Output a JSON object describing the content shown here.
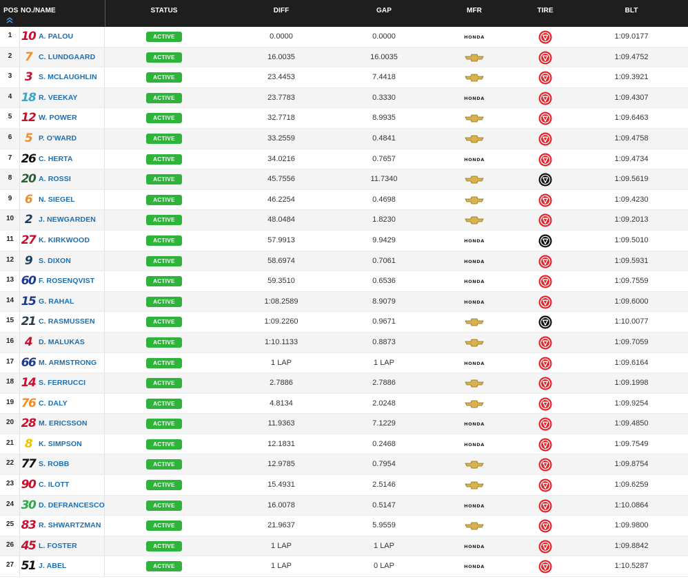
{
  "header": {
    "pos": "POS",
    "name": "NO./NAME",
    "status": "STATUS",
    "diff": "DIFF",
    "gap": "GAP",
    "mfr": "MFR",
    "tire": "TIRE",
    "blt": "BLT",
    "sort_icon": "double-chevron-up-icon"
  },
  "colors": {
    "header_bg": "#1e1e1e",
    "driver_link": "#1a6fb5",
    "status_active": "#2fb43b",
    "tire_alternate": "#e3262b",
    "tire_primary": "#111111"
  },
  "rows": [
    {
      "pos": "1",
      "num": "10",
      "num_color": "#c8102e",
      "name": "A. PALOU",
      "status": "ACTIVE",
      "diff": "0.0000",
      "gap": "0.0000",
      "mfr": "HONDA",
      "tire": "alternate",
      "blt": "1:09.0177"
    },
    {
      "pos": "2",
      "num": "7",
      "num_color": "#f28c28",
      "name": "C. LUNDGAARD",
      "status": "ACTIVE",
      "diff": "16.0035",
      "gap": "16.0035",
      "mfr": "CHEVROLET",
      "tire": "alternate",
      "blt": "1:09.4752"
    },
    {
      "pos": "3",
      "num": "3",
      "num_color": "#c8102e",
      "name": "S. MCLAUGHLIN",
      "status": "ACTIVE",
      "diff": "23.4453",
      "gap": "7.4418",
      "mfr": "CHEVROLET",
      "tire": "alternate",
      "blt": "1:09.3921"
    },
    {
      "pos": "4",
      "num": "18",
      "num_color": "#3aa6c9",
      "name": "R. VEEKAY",
      "status": "ACTIVE",
      "diff": "23.7783",
      "gap": "0.3330",
      "mfr": "HONDA",
      "tire": "alternate",
      "blt": "1:09.4307"
    },
    {
      "pos": "5",
      "num": "12",
      "num_color": "#c8102e",
      "name": "W. POWER",
      "status": "ACTIVE",
      "diff": "32.7718",
      "gap": "8.9935",
      "mfr": "CHEVROLET",
      "tire": "alternate",
      "blt": "1:09.6463"
    },
    {
      "pos": "6",
      "num": "5",
      "num_color": "#f28c28",
      "name": "P. O'WARD",
      "status": "ACTIVE",
      "diff": "33.2559",
      "gap": "0.4841",
      "mfr": "CHEVROLET",
      "tire": "alternate",
      "blt": "1:09.4758"
    },
    {
      "pos": "7",
      "num": "26",
      "num_color": "#111111",
      "name": "C. HERTA",
      "status": "ACTIVE",
      "diff": "34.0216",
      "gap": "0.7657",
      "mfr": "HONDA",
      "tire": "alternate",
      "blt": "1:09.4734"
    },
    {
      "pos": "8",
      "num": "20",
      "num_color": "#2e5e3a",
      "name": "A. ROSSI",
      "status": "ACTIVE",
      "diff": "45.7556",
      "gap": "11.7340",
      "mfr": "CHEVROLET",
      "tire": "primary",
      "blt": "1:09.5619"
    },
    {
      "pos": "9",
      "num": "6",
      "num_color": "#f28c28",
      "name": "N. SIEGEL",
      "status": "ACTIVE",
      "diff": "46.2254",
      "gap": "0.4698",
      "mfr": "CHEVROLET",
      "tire": "alternate",
      "blt": "1:09.4230"
    },
    {
      "pos": "10",
      "num": "2",
      "num_color": "#1d3a5f",
      "name": "J. NEWGARDEN",
      "status": "ACTIVE",
      "diff": "48.0484",
      "gap": "1.8230",
      "mfr": "CHEVROLET",
      "tire": "alternate",
      "blt": "1:09.2013"
    },
    {
      "pos": "11",
      "num": "27",
      "num_color": "#c8102e",
      "name": "K. KIRKWOOD",
      "status": "ACTIVE",
      "diff": "57.9913",
      "gap": "9.9429",
      "mfr": "HONDA",
      "tire": "primary",
      "blt": "1:09.5010"
    },
    {
      "pos": "12",
      "num": "9",
      "num_color": "#1d3a5f",
      "name": "S. DIXON",
      "status": "ACTIVE",
      "diff": "58.6974",
      "gap": "0.7061",
      "mfr": "HONDA",
      "tire": "alternate",
      "blt": "1:09.5931"
    },
    {
      "pos": "13",
      "num": "60",
      "num_color": "#1d3a8f",
      "name": "F. ROSENQVIST",
      "status": "ACTIVE",
      "diff": "59.3510",
      "gap": "0.6536",
      "mfr": "HONDA",
      "tire": "alternate",
      "blt": "1:09.7559"
    },
    {
      "pos": "14",
      "num": "15",
      "num_color": "#1d3a8f",
      "name": "G. RAHAL",
      "status": "ACTIVE",
      "diff": "1:08.2589",
      "gap": "8.9079",
      "mfr": "HONDA",
      "tire": "alternate",
      "blt": "1:09.6000"
    },
    {
      "pos": "15",
      "num": "21",
      "num_color": "#2a3f4f",
      "name": "C. RASMUSSEN",
      "status": "ACTIVE",
      "diff": "1:09.2260",
      "gap": "0.9671",
      "mfr": "CHEVROLET",
      "tire": "primary",
      "blt": "1:10.0077"
    },
    {
      "pos": "16",
      "num": "4",
      "num_color": "#c8102e",
      "name": "D. MALUKAS",
      "status": "ACTIVE",
      "diff": "1:10.1133",
      "gap": "0.8873",
      "mfr": "CHEVROLET",
      "tire": "alternate",
      "blt": "1:09.7059"
    },
    {
      "pos": "17",
      "num": "66",
      "num_color": "#1d3a8f",
      "name": "M. ARMSTRONG",
      "status": "ACTIVE",
      "diff": "1 LAP",
      "gap": "1 LAP",
      "mfr": "HONDA",
      "tire": "alternate",
      "blt": "1:09.6164"
    },
    {
      "pos": "18",
      "num": "14",
      "num_color": "#c8102e",
      "name": "S. FERRUCCI",
      "status": "ACTIVE",
      "diff": "2.7886",
      "gap": "2.7886",
      "mfr": "CHEVROLET",
      "tire": "alternate",
      "blt": "1:09.1998"
    },
    {
      "pos": "19",
      "num": "76",
      "num_color": "#f28c28",
      "name": "C. DALY",
      "status": "ACTIVE",
      "diff": "4.8134",
      "gap": "2.0248",
      "mfr": "CHEVROLET",
      "tire": "alternate",
      "blt": "1:09.9254"
    },
    {
      "pos": "20",
      "num": "28",
      "num_color": "#c8102e",
      "name": "M. ERICSSON",
      "status": "ACTIVE",
      "diff": "11.9363",
      "gap": "7.1229",
      "mfr": "HONDA",
      "tire": "alternate",
      "blt": "1:09.4850"
    },
    {
      "pos": "21",
      "num": "8",
      "num_color": "#f2c200",
      "name": "K. SIMPSON",
      "status": "ACTIVE",
      "diff": "12.1831",
      "gap": "0.2468",
      "mfr": "HONDA",
      "tire": "alternate",
      "blt": "1:09.7549"
    },
    {
      "pos": "22",
      "num": "77",
      "num_color": "#111111",
      "name": "S. ROBB",
      "status": "ACTIVE",
      "diff": "12.9785",
      "gap": "0.7954",
      "mfr": "CHEVROLET",
      "tire": "alternate",
      "blt": "1:09.8754"
    },
    {
      "pos": "23",
      "num": "90",
      "num_color": "#c8102e",
      "name": "C. ILOTT",
      "status": "ACTIVE",
      "diff": "15.4931",
      "gap": "2.5146",
      "mfr": "CHEVROLET",
      "tire": "alternate",
      "blt": "1:09.6259"
    },
    {
      "pos": "24",
      "num": "30",
      "num_color": "#2fa84f",
      "name": "D. DEFRANCESCO",
      "status": "ACTIVE",
      "diff": "16.0078",
      "gap": "0.5147",
      "mfr": "HONDA",
      "tire": "alternate",
      "blt": "1:10.0864"
    },
    {
      "pos": "25",
      "num": "83",
      "num_color": "#c8102e",
      "name": "R. SHWARTZMAN",
      "status": "ACTIVE",
      "diff": "21.9637",
      "gap": "5.9559",
      "mfr": "CHEVROLET",
      "tire": "alternate",
      "blt": "1:09.9800"
    },
    {
      "pos": "26",
      "num": "45",
      "num_color": "#c8102e",
      "name": "L. FOSTER",
      "status": "ACTIVE",
      "diff": "1 LAP",
      "gap": "1 LAP",
      "mfr": "HONDA",
      "tire": "alternate",
      "blt": "1:09.8842"
    },
    {
      "pos": "27",
      "num": "51",
      "num_color": "#111111",
      "name": "J. ABEL",
      "status": "ACTIVE",
      "diff": "1 LAP",
      "gap": "0 LAP",
      "mfr": "HONDA",
      "tire": "alternate",
      "blt": "1:10.5287"
    }
  ]
}
